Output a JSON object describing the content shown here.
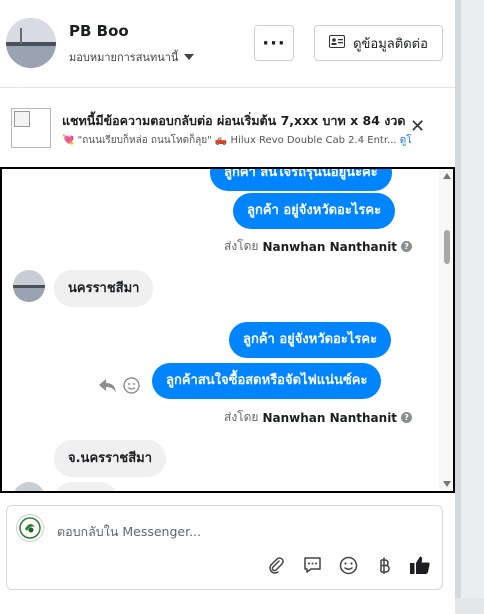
{
  "header": {
    "name": "PB Boo",
    "assign_label": "มอบหมายการสนทนานี้",
    "more_label": "···",
    "contact_button": "ดูข้อมูลติดต่อ"
  },
  "preview": {
    "title": "แชทนี้มีข้อความตอบกลับต่อ ผ่อนเริ่มต้น 7,xxx บาท x 84 งวด",
    "subtitle_prefix": "💘 \"ถนนเรียบก็หล่อ ถนนโหดก็ลุย\" 🛻 Hilux Revo Double Cab 2.4 Entr...",
    "subtitle_link": "ดูโ"
  },
  "messages": {
    "top_partial": "ลูกค้า สนใจรถรุ่นนี้อยู่นะคะ",
    "out1": "ลูกค้า อยู่จังหวัดอะไรคะ",
    "sent_by_label": "ส่งโดย",
    "sent_by_name": "Nanwhan Nanthanit",
    "in1": "นครราชสีมา",
    "out2": "ลูกค้า  อยู่จังหวัดอะไรคะ",
    "out3": "ลูกค้าสนใจซื้อสดหรือจัดไฟแน่นซ์คะ",
    "sent_by_label2": "ส่งโดย",
    "sent_by_name2": "Nanwhan Nanthanit",
    "in2": "จ.นครราชสีมา"
  },
  "composer": {
    "placeholder": "ตอบกลับใน Messenger..."
  },
  "icons": {
    "more": "ellipsis-icon",
    "contact": "id-card-icon",
    "close": "close-icon",
    "attach": "paperclip-icon",
    "saved_reply": "chat-bubble-icon",
    "emoji": "smiley-icon",
    "payment": "baht-icon",
    "like": "thumbs-up-icon"
  },
  "colors": {
    "bubble_outgoing": "#0084ff",
    "bubble_incoming": "#f0f0f0",
    "link": "#1877f2"
  }
}
